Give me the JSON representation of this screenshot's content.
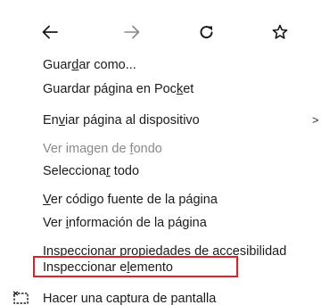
{
  "nav": {
    "back_icon": "arrow-left-icon",
    "forward_icon": "arrow-right-icon",
    "reload_icon": "reload-icon",
    "bookmark_icon": "star-icon"
  },
  "items": [
    {
      "pre": "Guar",
      "key": "d",
      "post": "ar como..."
    },
    {
      "pre": "Guardar página en Poc",
      "key": "k",
      "post": "et"
    },
    {
      "pre": "En",
      "key": "v",
      "post": "iar página al dispositivo"
    },
    {
      "pre": "Ver imagen de ",
      "key": "f",
      "post": "ondo"
    },
    {
      "pre": "Selecciona",
      "key": "r",
      "post": " todo"
    },
    {
      "pre": "",
      "key": "V",
      "post": "er código fuente de la página"
    },
    {
      "pre": "Ver ",
      "key": "i",
      "post": "nformación de la página"
    },
    {
      "pre": "Inspeccionar propiedades de accesibilidad",
      "key": "",
      "post": ""
    },
    {
      "pre": "Inspeccionar e",
      "key": "l",
      "post": "emento"
    },
    {
      "pre": "Hacer una captura de pantalla",
      "key": "",
      "post": ""
    }
  ],
  "submenu_arrow": ">",
  "colors": {
    "highlight": "#e3202a",
    "disabled_text": "#8a8a8a",
    "text": "#1b1b1b"
  }
}
